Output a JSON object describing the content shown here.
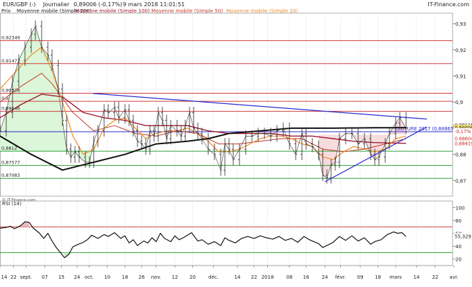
{
  "header": {
    "symbol": "EUR/GBP (-)",
    "period": "Journalier",
    "last": "0,89006 (-0,17%)",
    "datetime": "9 mars 2018 11:01:51",
    "brand": "IT-Finance.com"
  },
  "legend": [
    {
      "label": "Prix",
      "color": "#222222"
    },
    {
      "label": "Moyenne mobile (Simple 200)",
      "color": "#222222"
    },
    {
      "label": "Moyenne mobile (Simple 100)",
      "color": "#a01830"
    },
    {
      "label": "Moyenne mobile (Simple 50)",
      "color": "#c0392b"
    },
    {
      "label": "Moyenne mobile (Simple 20)",
      "color": "#f08a24"
    }
  ],
  "watermark": "© IT-Finance.com",
  "chart_data": {
    "type": "line",
    "price_axis": {
      "ylim": [
        0.864,
        0.934
      ],
      "ticks": [
        "0,93",
        "0,92",
        "0,91",
        "0,9",
        "0,89",
        "0,88",
        "0,87"
      ],
      "tick_values": [
        0.93,
        0.92,
        0.91,
        0.9,
        0.89,
        0.88,
        0.87
      ]
    },
    "x_ticks": [
      "14",
      "22",
      "sept.",
      "07",
      "15",
      "24",
      "oct.",
      "10",
      "18",
      "26",
      "nov.",
      "12",
      "20",
      "déc.",
      "14",
      "22",
      "2018",
      "08",
      "16",
      "24",
      "févr.",
      "09",
      "18",
      "mars",
      "14",
      "22",
      "avr."
    ],
    "x_tick_pos": [
      0,
      0.065,
      0.125,
      0.215,
      0.295,
      0.37,
      0.428,
      0.515,
      0.6,
      0.68,
      0.75,
      0.84,
      0.925,
      1.025,
      1.14,
      1.22,
      1.285,
      1.39,
      1.47,
      1.56,
      1.635,
      1.73,
      1.815,
      1.9,
      2.0,
      2.09,
      2.18
    ],
    "levels": [
      {
        "label": "0,92349",
        "value": 0.92349,
        "color": "#d23a3a"
      },
      {
        "label": "0,91471",
        "value": 0.91471,
        "color": "#d23a3a"
      },
      {
        "label": "0,90338",
        "value": 0.90338,
        "color": "#d23a3a"
      },
      {
        "label": "0,9",
        "value": 0.9003,
        "color": "#d23a3a"
      },
      {
        "label": "0,89646",
        "value": 0.89646,
        "color": "#d23a3a"
      },
      {
        "label": "0,8812",
        "value": 0.8812,
        "color": "#2e9e3a"
      },
      {
        "label": "0,87577",
        "value": 0.87577,
        "color": "#2e9e3a"
      },
      {
        "label": "0,87083",
        "value": 0.87083,
        "color": "#2e9e3a"
      }
    ],
    "cloture": {
      "label": "CLOTURE 2017 (0,88865)",
      "value": 0.88865,
      "color": "#2a2ad0"
    },
    "price_tags": [
      {
        "text": "0,89115",
        "value": 0.89115,
        "bg": "#ffffff",
        "fg": "#222222"
      },
      {
        "text": "0,89006",
        "value": 0.89006,
        "bg": "#f3df7a",
        "fg": "#222222"
      },
      {
        "text": "-0,17%",
        "value": 0.88885,
        "bg": "#ffffff",
        "fg": "#cc2222"
      },
      {
        "text": "0,88604",
        "value": 0.88604,
        "bg": "#ffffff",
        "fg": "#cc2222"
      },
      {
        "text": "0,88419",
        "value": 0.88419,
        "bg": "#ffffff",
        "fg": "#cc2222"
      }
    ],
    "price": [
      [
        0.0,
        0.889
      ],
      [
        0.03,
        0.896
      ],
      [
        0.06,
        0.908
      ],
      [
        0.09,
        0.916
      ],
      [
        0.12,
        0.921
      ],
      [
        0.15,
        0.926
      ],
      [
        0.17,
        0.929
      ],
      [
        0.2,
        0.921
      ],
      [
        0.23,
        0.918
      ],
      [
        0.25,
        0.914
      ],
      [
        0.28,
        0.905
      ],
      [
        0.3,
        0.893
      ],
      [
        0.32,
        0.882
      ],
      [
        0.34,
        0.879
      ],
      [
        0.36,
        0.881
      ],
      [
        0.38,
        0.879
      ],
      [
        0.41,
        0.877
      ],
      [
        0.43,
        0.877
      ],
      [
        0.45,
        0.885
      ],
      [
        0.47,
        0.889
      ],
      [
        0.5,
        0.897
      ],
      [
        0.52,
        0.896
      ],
      [
        0.55,
        0.898
      ],
      [
        0.57,
        0.894
      ],
      [
        0.6,
        0.897
      ],
      [
        0.62,
        0.893
      ],
      [
        0.64,
        0.889
      ],
      [
        0.66,
        0.885
      ],
      [
        0.68,
        0.884
      ],
      [
        0.7,
        0.882
      ],
      [
        0.72,
        0.889
      ],
      [
        0.74,
        0.887
      ],
      [
        0.76,
        0.896
      ],
      [
        0.78,
        0.893
      ],
      [
        0.8,
        0.886
      ],
      [
        0.82,
        0.891
      ],
      [
        0.85,
        0.889
      ],
      [
        0.87,
        0.887
      ],
      [
        0.89,
        0.891
      ],
      [
        0.91,
        0.896
      ],
      [
        0.93,
        0.89
      ],
      [
        0.95,
        0.888
      ],
      [
        0.97,
        0.886
      ],
      [
        1.0,
        0.882
      ],
      [
        1.03,
        0.88
      ],
      [
        1.06,
        0.874
      ],
      [
        1.08,
        0.884
      ],
      [
        1.1,
        0.882
      ],
      [
        1.12,
        0.878
      ],
      [
        1.15,
        0.882
      ],
      [
        1.18,
        0.887
      ],
      [
        1.21,
        0.887
      ],
      [
        1.24,
        0.888
      ],
      [
        1.27,
        0.888
      ],
      [
        1.3,
        0.887
      ],
      [
        1.33,
        0.889
      ],
      [
        1.36,
        0.89
      ],
      [
        1.39,
        0.884
      ],
      [
        1.42,
        0.88
      ],
      [
        1.45,
        0.888
      ],
      [
        1.47,
        0.884
      ],
      [
        1.5,
        0.883
      ],
      [
        1.53,
        0.88
      ],
      [
        1.55,
        0.872
      ],
      [
        1.57,
        0.871
      ],
      [
        1.59,
        0.876
      ],
      [
        1.61,
        0.877
      ],
      [
        1.63,
        0.886
      ],
      [
        1.66,
        0.888
      ],
      [
        1.69,
        0.888
      ],
      [
        1.72,
        0.884
      ],
      [
        1.75,
        0.886
      ],
      [
        1.78,
        0.88
      ],
      [
        1.8,
        0.878
      ],
      [
        1.82,
        0.879
      ],
      [
        1.85,
        0.884
      ],
      [
        1.87,
        0.888
      ],
      [
        1.9,
        0.892
      ],
      [
        1.92,
        0.894
      ],
      [
        1.95,
        0.89
      ]
    ],
    "ma200": [
      [
        0.0,
        0.887
      ],
      [
        0.15,
        0.88
      ],
      [
        0.3,
        0.874
      ],
      [
        0.45,
        0.877
      ],
      [
        0.6,
        0.88
      ],
      [
        0.75,
        0.884
      ],
      [
        0.9,
        0.885
      ],
      [
        1.0,
        0.886
      ],
      [
        1.1,
        0.888
      ],
      [
        1.25,
        0.889
      ],
      [
        1.4,
        0.89
      ],
      [
        1.6,
        0.89
      ],
      [
        1.8,
        0.8902
      ],
      [
        1.95,
        0.8902
      ]
    ],
    "ma100": [
      [
        0.0,
        0.894
      ],
      [
        0.1,
        0.899
      ],
      [
        0.2,
        0.903
      ],
      [
        0.3,
        0.902
      ],
      [
        0.4,
        0.896
      ],
      [
        0.5,
        0.894
      ],
      [
        0.6,
        0.893
      ],
      [
        0.7,
        0.891
      ],
      [
        0.8,
        0.891
      ],
      [
        0.9,
        0.891
      ],
      [
        1.0,
        0.889
      ],
      [
        1.1,
        0.888
      ],
      [
        1.2,
        0.888
      ],
      [
        1.3,
        0.888
      ],
      [
        1.4,
        0.887
      ],
      [
        1.5,
        0.887
      ],
      [
        1.6,
        0.886
      ],
      [
        1.7,
        0.885
      ],
      [
        1.8,
        0.8845
      ],
      [
        1.95,
        0.8842
      ]
    ],
    "ma50": [
      [
        0.0,
        0.9
      ],
      [
        0.1,
        0.906
      ],
      [
        0.2,
        0.911
      ],
      [
        0.25,
        0.907
      ],
      [
        0.35,
        0.896
      ],
      [
        0.45,
        0.889
      ],
      [
        0.55,
        0.891
      ],
      [
        0.65,
        0.888
      ],
      [
        0.75,
        0.887
      ],
      [
        0.85,
        0.889
      ],
      [
        0.95,
        0.888
      ],
      [
        1.05,
        0.884
      ],
      [
        1.15,
        0.884
      ],
      [
        1.25,
        0.885
      ],
      [
        1.35,
        0.886
      ],
      [
        1.45,
        0.886
      ],
      [
        1.55,
        0.882
      ],
      [
        1.65,
        0.881
      ],
      [
        1.75,
        0.882
      ],
      [
        1.85,
        0.884
      ],
      [
        1.95,
        0.886
      ]
    ],
    "ma20": [
      [
        0.0,
        0.905
      ],
      [
        0.08,
        0.912
      ],
      [
        0.15,
        0.918
      ],
      [
        0.2,
        0.921
      ],
      [
        0.25,
        0.912
      ],
      [
        0.3,
        0.9
      ],
      [
        0.35,
        0.887
      ],
      [
        0.4,
        0.88
      ],
      [
        0.45,
        0.882
      ],
      [
        0.5,
        0.89
      ],
      [
        0.55,
        0.893
      ],
      [
        0.6,
        0.894
      ],
      [
        0.65,
        0.89
      ],
      [
        0.7,
        0.886
      ],
      [
        0.75,
        0.888
      ],
      [
        0.8,
        0.889
      ],
      [
        0.85,
        0.889
      ],
      [
        0.9,
        0.89
      ],
      [
        0.95,
        0.888
      ],
      [
        1.0,
        0.885
      ],
      [
        1.05,
        0.881
      ],
      [
        1.1,
        0.881
      ],
      [
        1.15,
        0.882
      ],
      [
        1.2,
        0.884
      ],
      [
        1.25,
        0.886
      ],
      [
        1.3,
        0.887
      ],
      [
        1.35,
        0.887
      ],
      [
        1.4,
        0.886
      ],
      [
        1.45,
        0.884
      ],
      [
        1.5,
        0.883
      ],
      [
        1.55,
        0.879
      ],
      [
        1.6,
        0.878
      ],
      [
        1.65,
        0.881
      ],
      [
        1.7,
        0.883
      ],
      [
        1.75,
        0.882
      ],
      [
        1.8,
        0.881
      ],
      [
        1.85,
        0.882
      ],
      [
        1.9,
        0.886
      ],
      [
        1.95,
        0.887
      ]
    ],
    "trendlines": [
      {
        "from": [
          0.445,
          0.9033
        ],
        "to": [
          2.05,
          0.8935
        ],
        "color": "#2a2ad0"
      },
      {
        "from": [
          1.56,
          0.8695
        ],
        "to": [
          2.05,
          0.8905
        ],
        "color": "#2a2ad0"
      }
    ],
    "rsi": {
      "label": "RSI (14)",
      "ylim": [
        10,
        110
      ],
      "ticks": [
        "100",
        "80",
        "60",
        "40",
        "20"
      ],
      "tick_values": [
        100,
        80,
        60,
        40,
        20
      ],
      "overbought": 70,
      "oversold": 30,
      "last": "55,329",
      "last_value": 55.329,
      "values": [
        [
          0.0,
          68
        ],
        [
          0.03,
          69
        ],
        [
          0.05,
          71
        ],
        [
          0.07,
          67
        ],
        [
          0.1,
          72
        ],
        [
          0.12,
          78
        ],
        [
          0.14,
          77
        ],
        [
          0.16,
          68
        ],
        [
          0.19,
          60
        ],
        [
          0.21,
          52
        ],
        [
          0.23,
          60
        ],
        [
          0.25,
          48
        ],
        [
          0.27,
          38
        ],
        [
          0.29,
          30
        ],
        [
          0.31,
          22
        ],
        [
          0.33,
          27
        ],
        [
          0.35,
          39
        ],
        [
          0.37,
          42
        ],
        [
          0.4,
          46
        ],
        [
          0.42,
          50
        ],
        [
          0.44,
          57
        ],
        [
          0.47,
          52
        ],
        [
          0.5,
          58
        ],
        [
          0.52,
          55
        ],
        [
          0.55,
          61
        ],
        [
          0.58,
          52
        ],
        [
          0.6,
          56
        ],
        [
          0.62,
          45
        ],
        [
          0.64,
          50
        ],
        [
          0.66,
          41
        ],
        [
          0.69,
          48
        ],
        [
          0.71,
          45
        ],
        [
          0.73,
          53
        ],
        [
          0.75,
          47
        ],
        [
          0.77,
          60
        ],
        [
          0.79,
          52
        ],
        [
          0.82,
          47
        ],
        [
          0.84,
          56
        ],
        [
          0.86,
          50
        ],
        [
          0.88,
          53
        ],
        [
          0.9,
          57
        ],
        [
          0.92,
          61
        ],
        [
          0.95,
          48
        ],
        [
          0.97,
          50
        ],
        [
          1.0,
          43
        ],
        [
          1.03,
          47
        ],
        [
          1.06,
          41
        ],
        [
          1.08,
          53
        ],
        [
          1.1,
          49
        ],
        [
          1.13,
          45
        ],
        [
          1.16,
          52
        ],
        [
          1.19,
          55
        ],
        [
          1.22,
          52
        ],
        [
          1.25,
          56
        ],
        [
          1.28,
          53
        ],
        [
          1.31,
          51
        ],
        [
          1.34,
          55
        ],
        [
          1.37,
          49
        ],
        [
          1.4,
          52
        ],
        [
          1.43,
          46
        ],
        [
          1.46,
          55
        ],
        [
          1.48,
          51
        ],
        [
          1.5,
          48
        ],
        [
          1.53,
          44
        ],
        [
          1.55,
          38
        ],
        [
          1.57,
          41
        ],
        [
          1.6,
          46
        ],
        [
          1.63,
          55
        ],
        [
          1.66,
          49
        ],
        [
          1.69,
          56
        ],
        [
          1.72,
          48
        ],
        [
          1.75,
          53
        ],
        [
          1.78,
          43
        ],
        [
          1.8,
          47
        ],
        [
          1.83,
          50
        ],
        [
          1.86,
          58
        ],
        [
          1.89,
          62
        ],
        [
          1.91,
          60
        ],
        [
          1.93,
          61
        ],
        [
          1.95,
          55
        ]
      ]
    }
  }
}
